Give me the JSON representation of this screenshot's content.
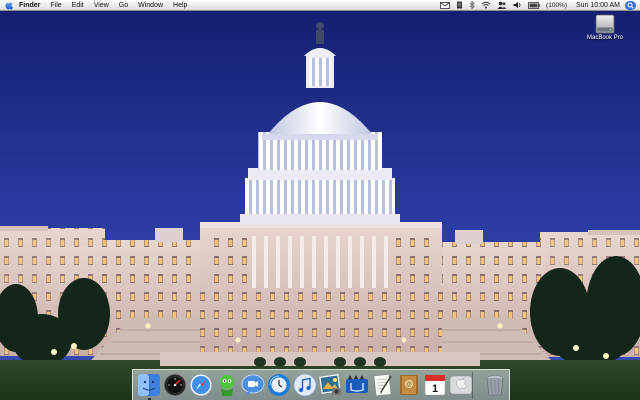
{
  "menubar": {
    "apple_icon": "apple-icon",
    "app_name": "Finder",
    "menus": [
      "File",
      "Edit",
      "View",
      "Go",
      "Window",
      "Help"
    ],
    "status": {
      "mail_icon": "mail-icon",
      "script_icon": "script-icon",
      "bluetooth_icon": "bluetooth-icon",
      "wifi_icon": "wifi-icon",
      "user_icon": "user-icon",
      "volume_icon": "volume-icon",
      "battery_icon": "battery-icon",
      "battery_text": "(100%)",
      "clock": "Sun 10:00 AM",
      "spotlight_icon": "spotlight-icon"
    }
  },
  "desktop": {
    "wallpaper": "capitol-building-night",
    "icons": [
      {
        "label": "MacBook Pro",
        "icon": "hard-drive-icon"
      }
    ]
  },
  "dock": {
    "items": [
      {
        "app": "finder-icon",
        "running": true
      },
      {
        "app": "dashboard-icon",
        "running": false
      },
      {
        "app": "safari-icon",
        "running": false
      },
      {
        "app": "ichat-icon",
        "running": false
      },
      {
        "app": "ichat-av-icon",
        "running": false
      },
      {
        "app": "time-machine-icon",
        "running": false
      },
      {
        "app": "itunes-icon",
        "running": false
      },
      {
        "app": "iphoto-icon",
        "running": false
      },
      {
        "app": "imovie-icon",
        "running": false
      },
      {
        "app": "textedit-icon",
        "running": false
      },
      {
        "app": "address-book-icon",
        "running": false
      },
      {
        "app": "ical-icon",
        "running": false
      },
      {
        "app": "system-preferences-icon",
        "running": false
      }
    ],
    "ical_date": "1",
    "trash_icon": "trash-icon"
  },
  "colors": {
    "sky": "#1f2c8c",
    "menubar": "#e9e9e9",
    "selection": "#3a72d8"
  }
}
